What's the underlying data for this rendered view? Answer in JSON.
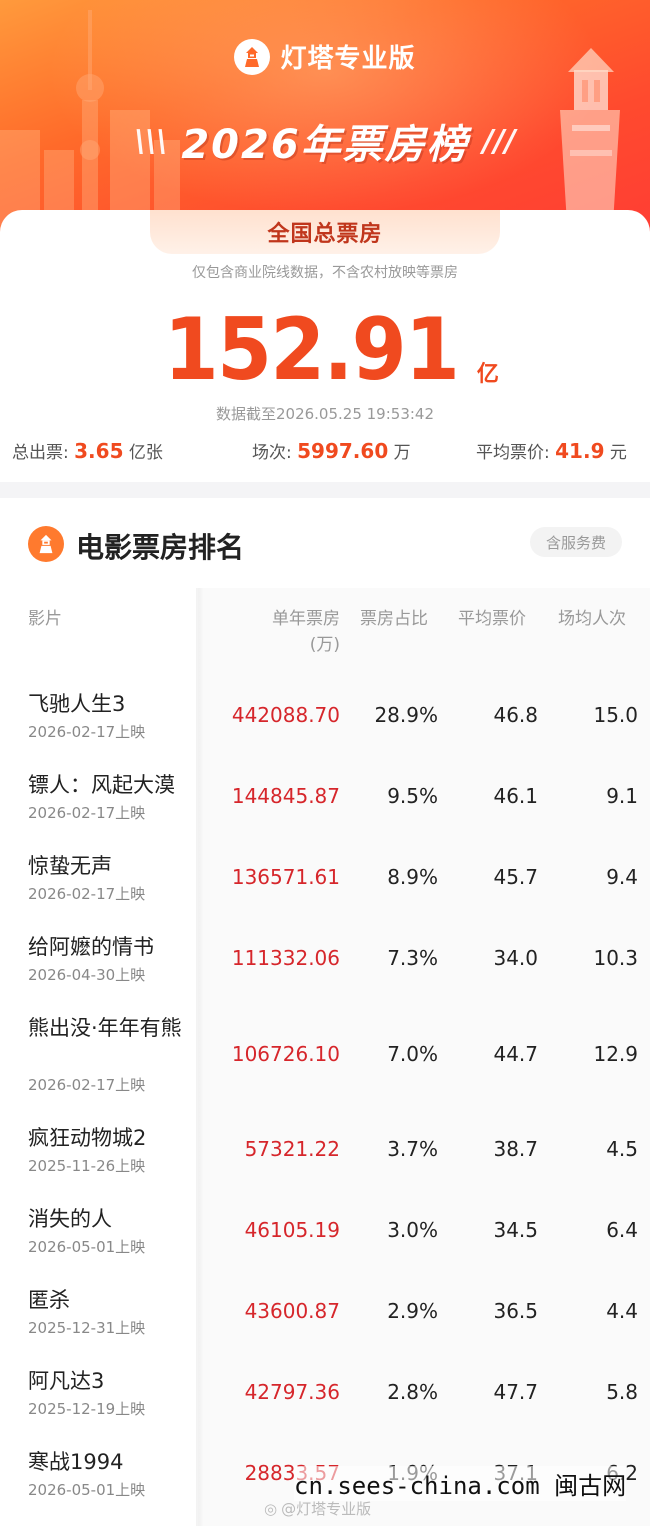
{
  "header": {
    "brand_name": "灯塔专业版",
    "title": "2026年票房榜",
    "colors": {
      "primary": "#ff5a2e",
      "accent_red": "#f04a1f",
      "value_red": "#d6262b"
    },
    "icons": [
      "lighthouse-logo-icon"
    ]
  },
  "summary": {
    "tab_label": "全国总票房",
    "note": "仅包含商业院线数据，不含农村放映等票房",
    "total_value": "152.91",
    "total_unit": "亿",
    "timestamp": "数据截至2026.05.25 19:53:42",
    "stats": {
      "tickets_label": "总出票: ",
      "tickets_value": "3.65",
      "tickets_unit": " 亿张",
      "shows_label": "场次: ",
      "shows_value": "5997.60",
      "shows_unit": " 万",
      "avg_price_label": "平均票价: ",
      "avg_price_value": "41.9",
      "avg_price_unit": " 元"
    }
  },
  "ranking": {
    "title": "电影票房排名",
    "badge": "含服务费",
    "columns": {
      "film": "影片",
      "box_office_line1": "单年票房",
      "box_office_line2": "(万)",
      "share": "票房占比",
      "avg_price": "平均票价",
      "per_show": "场均人次"
    },
    "rows": [
      {
        "name": "飞驰人生3",
        "date": "2026-02-17上映",
        "box_office": "442088.70",
        "share": "28.9%",
        "avg_price": "46.8",
        "per_show": "15.0"
      },
      {
        "name": "镖人：风起大漠",
        "date": "2026-02-17上映",
        "box_office": "144845.87",
        "share": "9.5%",
        "avg_price": "46.1",
        "per_show": "9.1"
      },
      {
        "name": "惊蛰无声",
        "date": "2026-02-17上映",
        "box_office": "136571.61",
        "share": "8.9%",
        "avg_price": "45.7",
        "per_show": "9.4"
      },
      {
        "name": "给阿嬷的情书",
        "date": "2026-04-30上映",
        "box_office": "111332.06",
        "share": "7.3%",
        "avg_price": "34.0",
        "per_show": "10.3"
      },
      {
        "name": "熊出没·年年有熊",
        "date": "2026-02-17上映",
        "box_office": "106726.10",
        "share": "7.0%",
        "avg_price": "44.7",
        "per_show": "12.9"
      },
      {
        "name": "疯狂动物城2",
        "date": "2025-11-26上映",
        "box_office": "57321.22",
        "share": "3.7%",
        "avg_price": "38.7",
        "per_show": "4.5"
      },
      {
        "name": "消失的人",
        "date": "2026-05-01上映",
        "box_office": "46105.19",
        "share": "3.0%",
        "avg_price": "34.5",
        "per_show": "6.4"
      },
      {
        "name": "匿杀",
        "date": "2025-12-31上映",
        "box_office": "43600.87",
        "share": "2.9%",
        "avg_price": "36.5",
        "per_show": "4.4"
      },
      {
        "name": "阿凡达3",
        "date": "2025-12-19上映",
        "box_office": "42797.36",
        "share": "2.8%",
        "avg_price": "47.7",
        "per_show": "5.8"
      },
      {
        "name": "寒战1994",
        "date": "2026-05-01上映",
        "box_office": "28833.57",
        "share": "1.9%",
        "avg_price": "37.1",
        "per_show": "6.2"
      }
    ]
  },
  "watermarks": {
    "site": "cn.sees-china.com 闽古网",
    "weibo": "@灯塔专业版"
  }
}
